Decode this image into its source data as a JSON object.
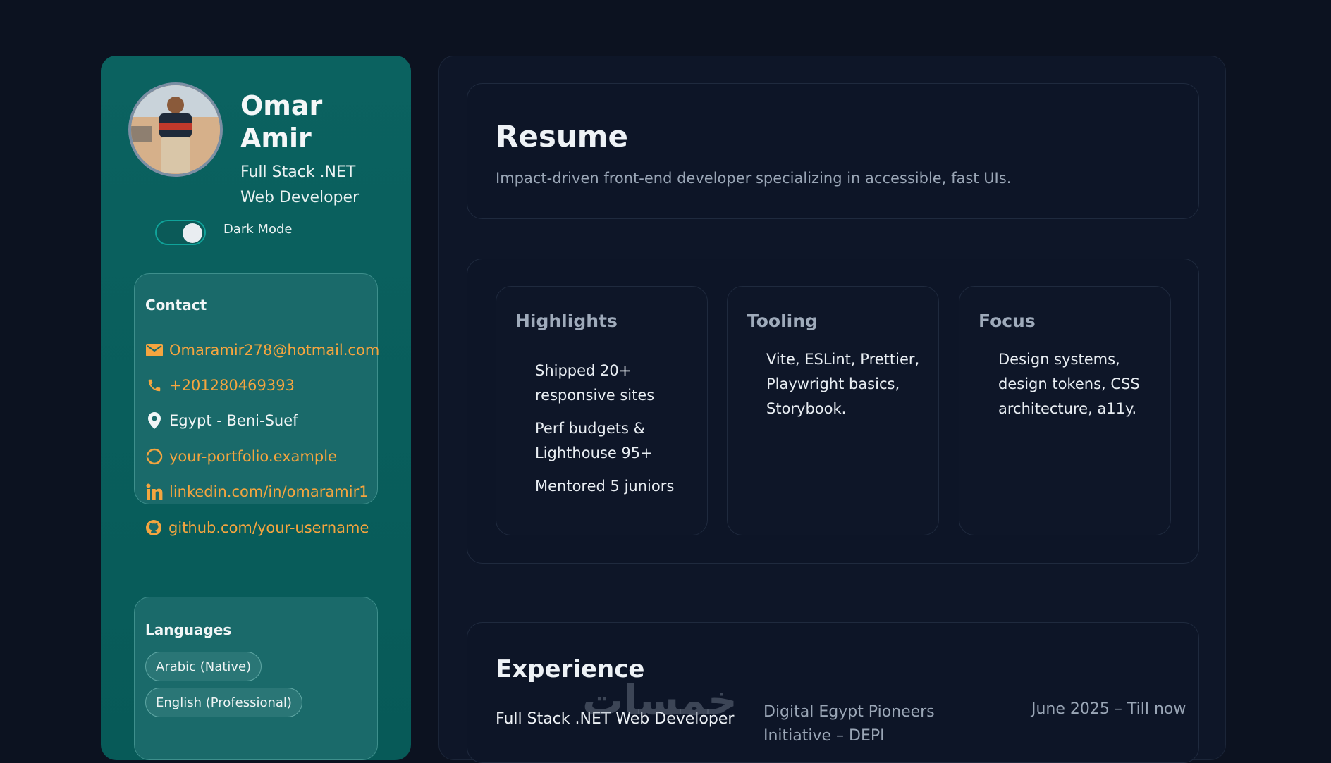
{
  "profile": {
    "first_name": "Omar",
    "last_name": "Amir",
    "role": "Full Stack .NET Web Developer",
    "dark_mode_label": "Dark Mode",
    "dark_mode_on": true
  },
  "contact": {
    "title": "Contact",
    "items": [
      {
        "icon": "mail-icon",
        "text": "Omaramir278@hotmail.com",
        "link": true
      },
      {
        "icon": "phone-icon",
        "text": "+201280469393",
        "link": true
      },
      {
        "icon": "location-pin-icon",
        "text": "Egypt - Beni-Suef",
        "link": false
      },
      {
        "icon": "globe-icon",
        "text": "your-portfolio.example",
        "link": true
      },
      {
        "icon": "linkedin-icon",
        "text": "linkedin.com/in/omaramir1",
        "link": true
      },
      {
        "icon": "github-icon",
        "text": "github.com/your-username",
        "link": true
      }
    ]
  },
  "languages": {
    "title": "Languages",
    "items": [
      "Arabic (Native)",
      "English (Professional)"
    ]
  },
  "resume": {
    "title": "Resume",
    "subtitle": "Impact-driven front-end developer specializing in accessible, fast UIs."
  },
  "highlights": [
    {
      "title": "Highlights",
      "items": [
        "Shipped 20+ responsive sites",
        "Perf budgets & Lighthouse 95+",
        "Mentored 5 juniors"
      ]
    },
    {
      "title": "Tooling",
      "items": [
        "Vite, ESLint, Prettier, Playwright basics, Storybook."
      ]
    },
    {
      "title": "Focus",
      "items": [
        "Design systems, design tokens, CSS architecture, a11y."
      ]
    }
  ],
  "experience": {
    "title": "Experience",
    "role": "Full Stack .NET Web Developer",
    "org": "Digital Egypt Pioneers Initiative – DEPI",
    "date": "June 2025 – Till now"
  },
  "watermark": "خمسات",
  "colors": {
    "background": "#0c1220",
    "sidebar": "#0b6260",
    "link": "#f5a53f",
    "panel": "#0d1527"
  }
}
